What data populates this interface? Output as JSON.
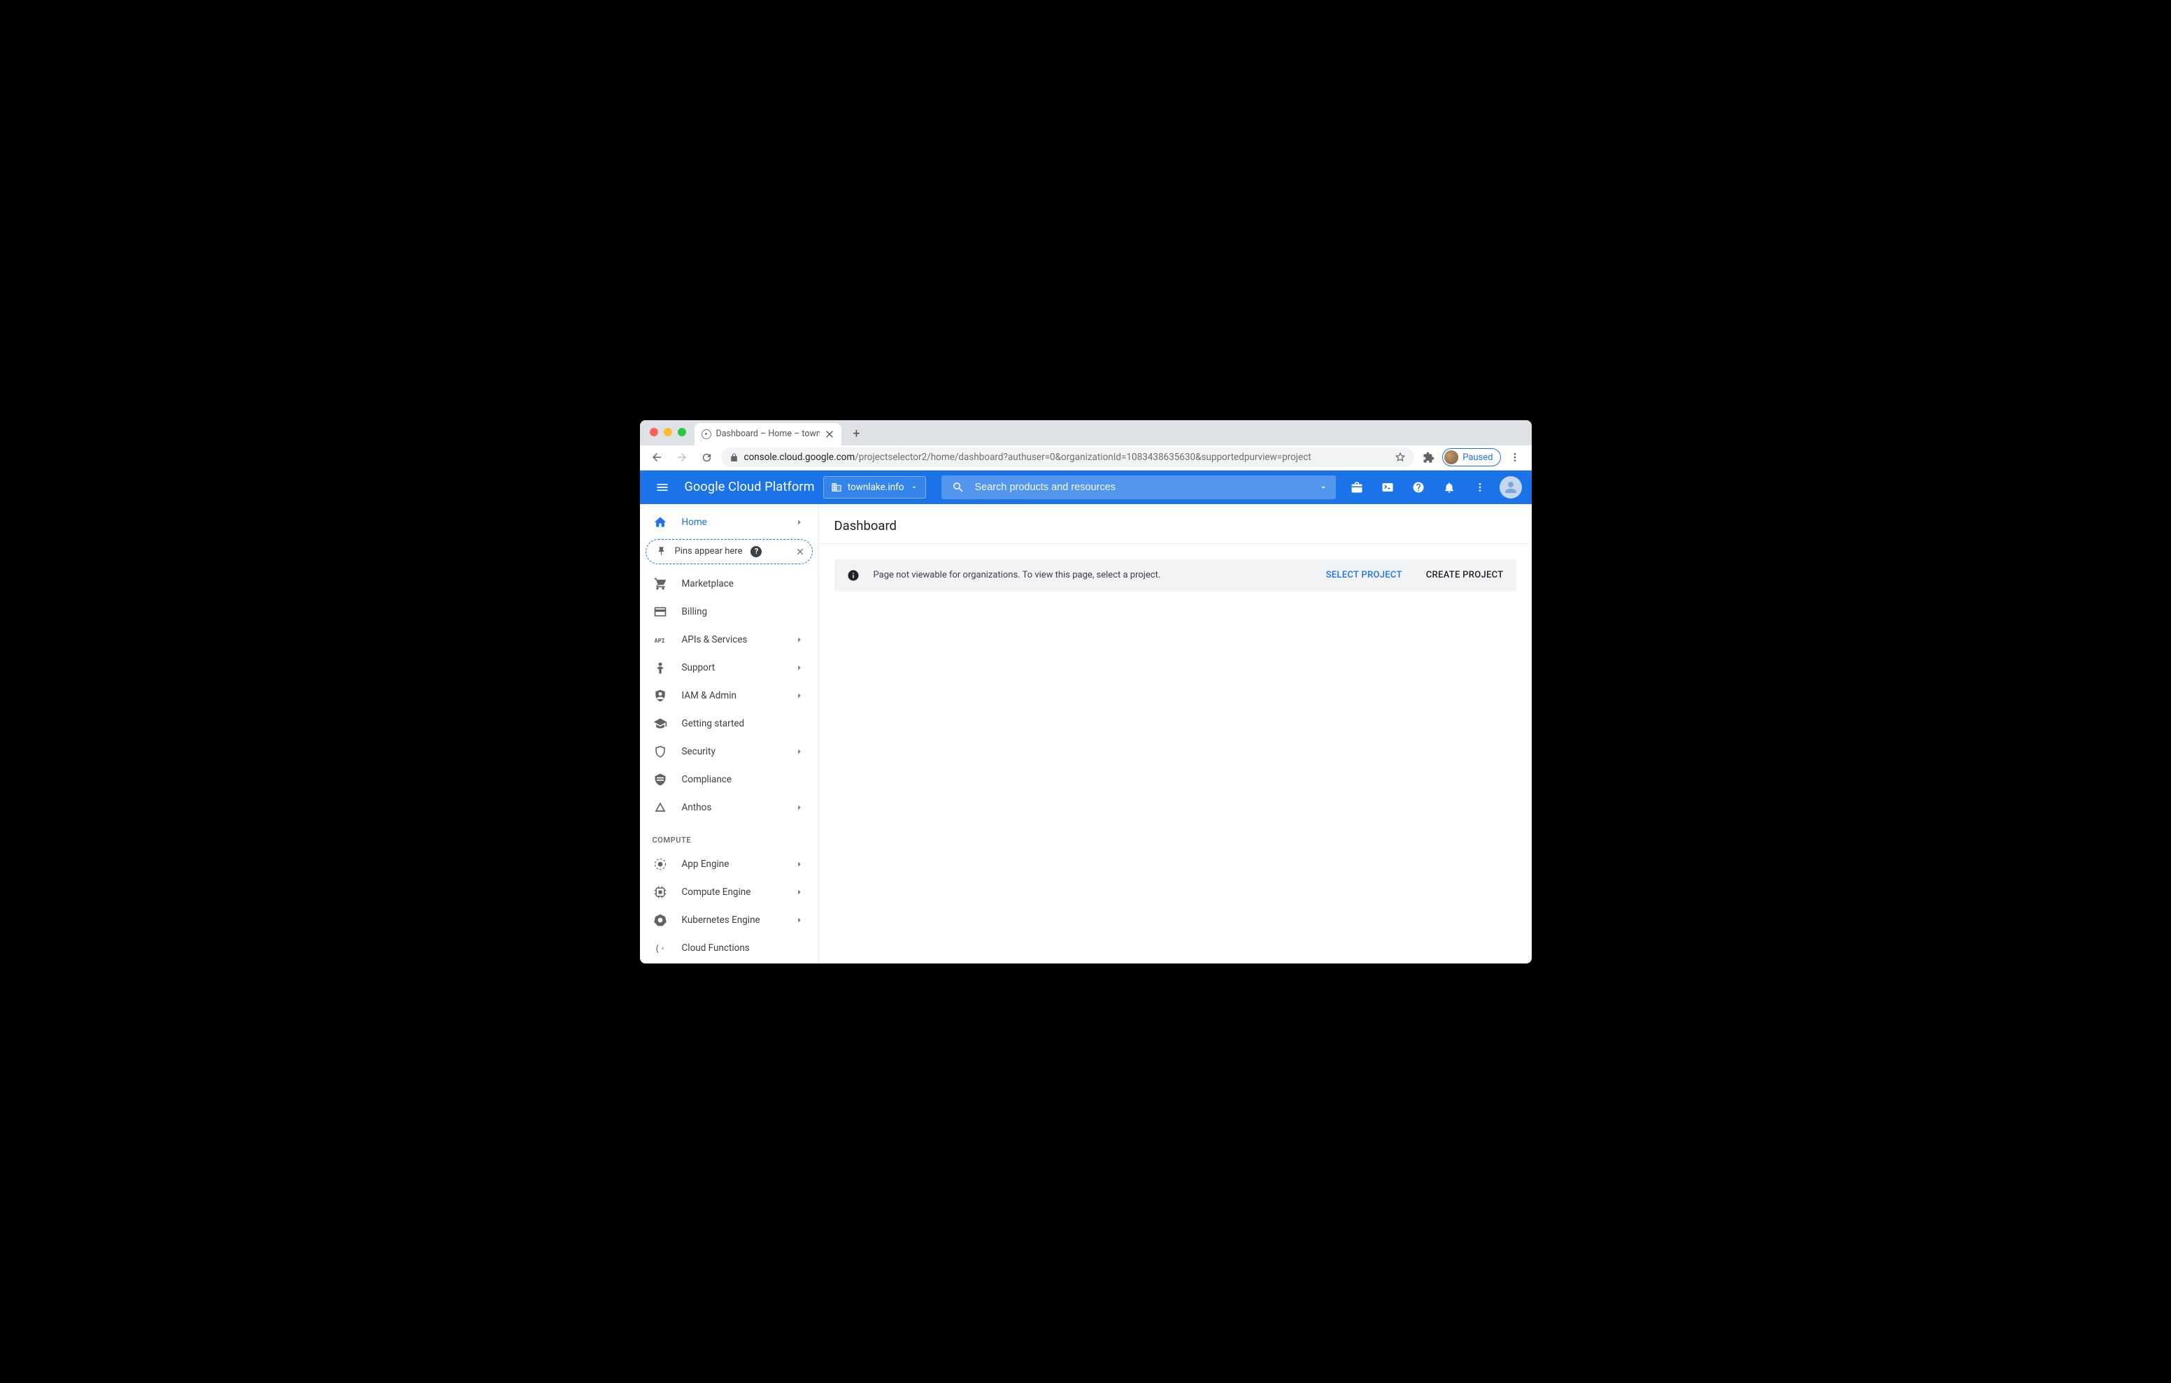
{
  "browser": {
    "tab_title": "Dashboard – Home – townlake",
    "url_host": "console.cloud.google.com",
    "url_path": "/projectselector2/home/dashboard?authuser=0&organizationId=1083438635630&supportedpurview=project",
    "paused_label": "Paused"
  },
  "header": {
    "brand": "Google Cloud Platform",
    "project": "townlake.info",
    "search_placeholder": "Search products and resources"
  },
  "sidebar": {
    "home": "Home",
    "pins_notice": "Pins appear here",
    "items_top": [
      {
        "label": "Marketplace",
        "icon": "cart",
        "chev": false
      },
      {
        "label": "Billing",
        "icon": "billing",
        "chev": false
      },
      {
        "label": "APIs & Services",
        "icon": "api",
        "chev": true
      },
      {
        "label": "Support",
        "icon": "support",
        "chev": true
      },
      {
        "label": "IAM & Admin",
        "icon": "iam",
        "chev": true
      },
      {
        "label": "Getting started",
        "icon": "grad",
        "chev": false
      },
      {
        "label": "Security",
        "icon": "security",
        "chev": true
      },
      {
        "label": "Compliance",
        "icon": "compliance",
        "chev": false
      },
      {
        "label": "Anthos",
        "icon": "anthos",
        "chev": true
      }
    ],
    "section_compute": "COMPUTE",
    "items_compute": [
      {
        "label": "App Engine",
        "icon": "appengine",
        "chev": true
      },
      {
        "label": "Compute Engine",
        "icon": "compute",
        "chev": true
      },
      {
        "label": "Kubernetes Engine",
        "icon": "k8s",
        "chev": true
      },
      {
        "label": "Cloud Functions",
        "icon": "functions",
        "chev": false
      }
    ]
  },
  "main": {
    "title": "Dashboard",
    "banner_message": "Page not viewable for organizations. To view this page, select a project.",
    "select_project": "SELECT PROJECT",
    "create_project": "CREATE PROJECT"
  }
}
